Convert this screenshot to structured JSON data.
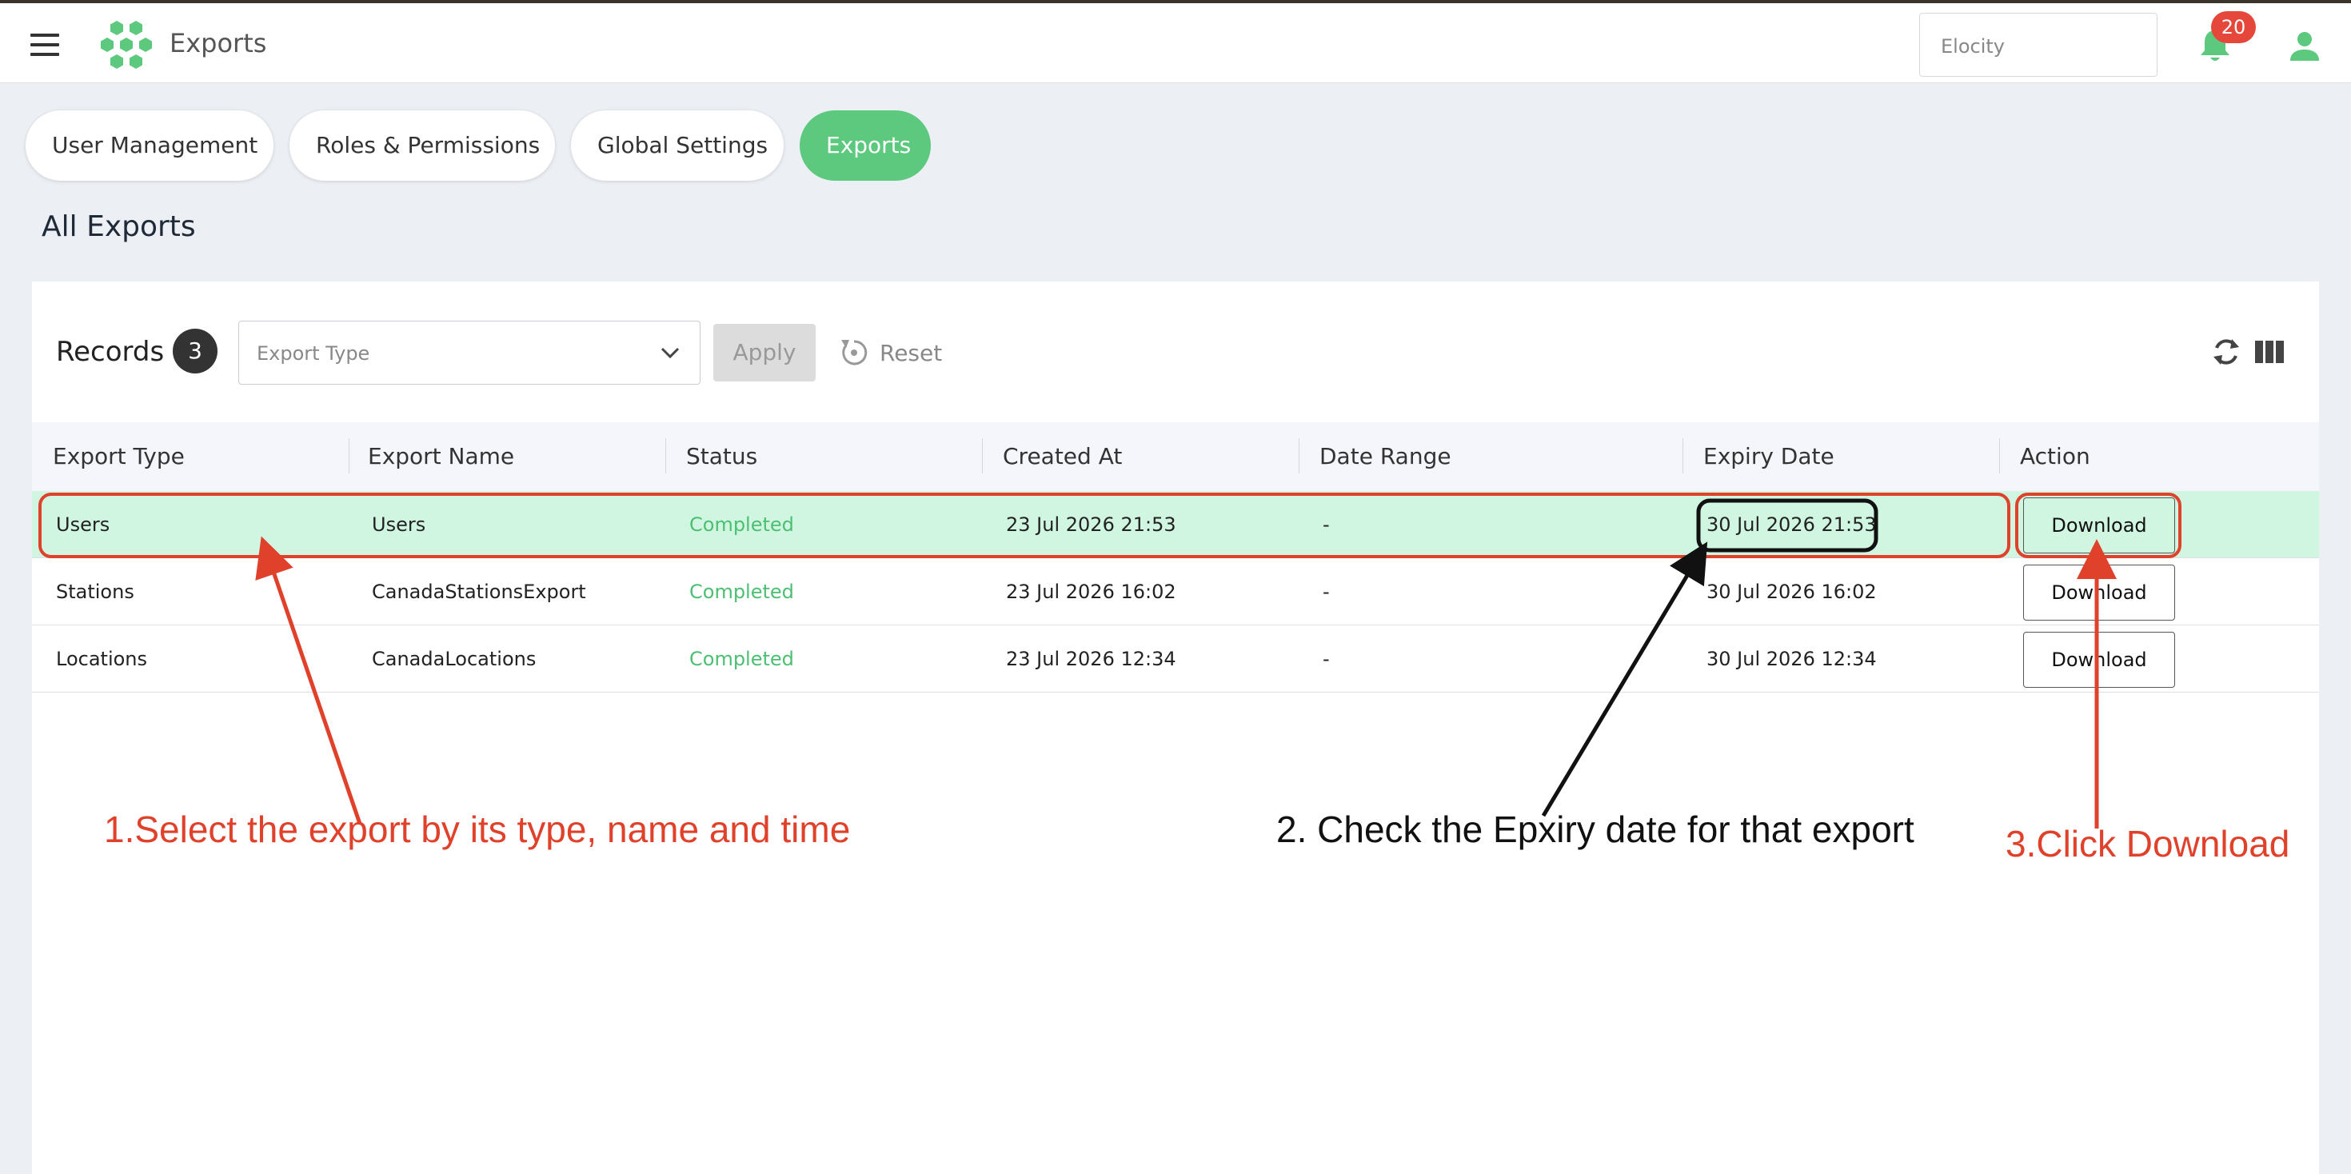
{
  "header": {
    "title": "Exports",
    "site_selector": "Elocity",
    "notification_count": "20"
  },
  "tabs": [
    {
      "label": "User Management",
      "active": false
    },
    {
      "label": "Roles & Permissions",
      "active": false
    },
    {
      "label": "Global Settings",
      "active": false
    },
    {
      "label": "Exports",
      "active": true
    }
  ],
  "page_title": "All Exports",
  "toolbar": {
    "records_label": "Records",
    "records_count": "3",
    "export_type_placeholder": "Export Type",
    "apply_label": "Apply",
    "reset_label": "Reset"
  },
  "table": {
    "columns": [
      "Export Type",
      "Export Name",
      "Status",
      "Created At",
      "Date Range",
      "Expiry Date",
      "Action"
    ],
    "rows": [
      {
        "type": "Users",
        "name": "Users",
        "status": "Completed",
        "created": "23 Jul 2026 21:53",
        "range": "-",
        "expiry": "30 Jul 2026 21:53",
        "action": "Download"
      },
      {
        "type": "Stations",
        "name": "CanadaStationsExport",
        "status": "Completed",
        "created": "23 Jul 2026 16:02",
        "range": "-",
        "expiry": "30 Jul 2026 16:02",
        "action": "Download"
      },
      {
        "type": "Locations",
        "name": "CanadaLocations",
        "status": "Completed",
        "created": "23 Jul 2026 12:34",
        "range": "-",
        "expiry": "30 Jul 2026 12:34",
        "action": "Download"
      }
    ]
  },
  "annotations": {
    "step1": "1.Select the export by its type, name and time",
    "step2": "2. Check the Epxiry date for that export",
    "step3": "3.Click Download"
  },
  "colors": {
    "accent": "#5cc97f",
    "highlight_row": "#d0f6e2",
    "status_completed": "#4cbf72",
    "badge": "#e5483a",
    "annotation_red": "#e0412b"
  }
}
